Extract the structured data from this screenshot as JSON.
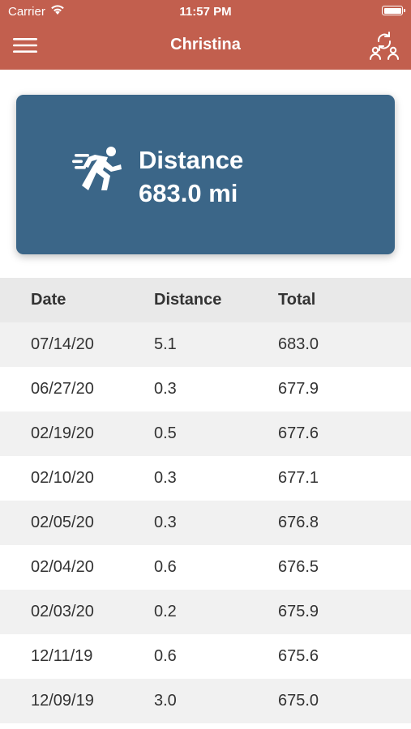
{
  "status": {
    "carrier": "Carrier",
    "time": "11:57 PM"
  },
  "nav": {
    "title": "Christina"
  },
  "summary": {
    "label": "Distance",
    "value": "683.0 mi"
  },
  "table": {
    "headers": [
      "Date",
      "Distance",
      "Total"
    ],
    "rows": [
      [
        "07/14/20",
        "5.1",
        "683.0"
      ],
      [
        "06/27/20",
        "0.3",
        "677.9"
      ],
      [
        "02/19/20",
        "0.5",
        "677.6"
      ],
      [
        "02/10/20",
        "0.3",
        "677.1"
      ],
      [
        "02/05/20",
        "0.3",
        "676.8"
      ],
      [
        "02/04/20",
        "0.6",
        "676.5"
      ],
      [
        "02/03/20",
        "0.2",
        "675.9"
      ],
      [
        "12/11/19",
        "0.6",
        "675.6"
      ],
      [
        "12/09/19",
        "3.0",
        "675.0"
      ]
    ]
  },
  "colors": {
    "header_bar": "#c25f4e",
    "card": "#3b6688",
    "row_alt": "#f1f1f1",
    "table_header": "#e9e9e9"
  },
  "icons": {
    "menu": "hamburger-menu-icon",
    "switch": "switch-user-icon",
    "runner": "running-person-icon"
  }
}
